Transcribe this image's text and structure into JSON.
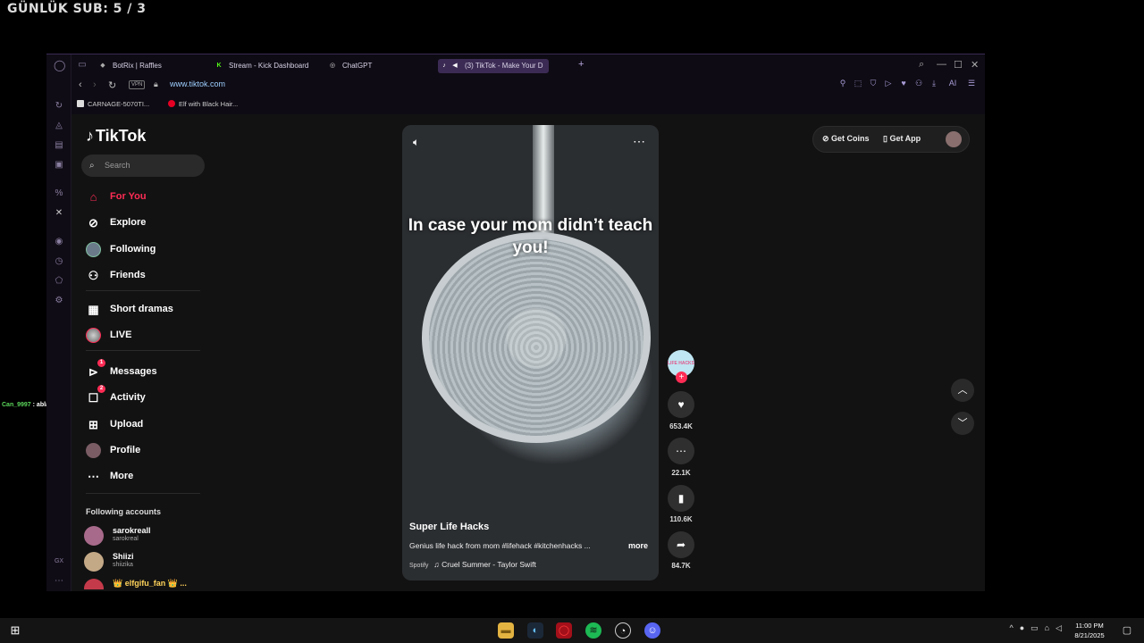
{
  "overlay": {
    "sub_counter": "GÜNLÜK SUB: 5 / 3",
    "chat_user": "Can_9997",
    "chat_msg": ": abla"
  },
  "browser": {
    "tabs": [
      {
        "label": "BotRix | Raffles",
        "fav": "◆"
      },
      {
        "label": "Stream - Kick Dashboard",
        "fav": "K"
      },
      {
        "label": "ChatGPT",
        "fav": "◎"
      },
      {
        "label": "(3) TikTok - Make Your D",
        "fav": "♪"
      }
    ],
    "url": "www.tiktok.com",
    "vpn": "VPN",
    "toolbar_ai": "AI",
    "bookmarks": [
      {
        "label": "CARNAGE-5070TI..."
      },
      {
        "label": "Elf with Black Hair..."
      }
    ]
  },
  "tiktok": {
    "logo": "TikTok",
    "search_placeholder": "Search",
    "nav": [
      {
        "label": "For You"
      },
      {
        "label": "Explore"
      },
      {
        "label": "Following"
      },
      {
        "label": "Friends"
      },
      {
        "label": "Short dramas"
      },
      {
        "label": "LIVE"
      },
      {
        "label": "Messages",
        "badge": "1"
      },
      {
        "label": "Activity",
        "badge": "2"
      },
      {
        "label": "Upload"
      },
      {
        "label": "Profile"
      },
      {
        "label": "More"
      }
    ],
    "following_title": "Following accounts",
    "accounts": [
      {
        "name": "sarokreall",
        "handle": "sarokreal"
      },
      {
        "name": "Shiizi",
        "handle": "shiizika"
      },
      {
        "name": "👑 elfgifu_fan 👑 ..."
      }
    ],
    "top": {
      "coins": "Get Coins",
      "app": "Get App"
    },
    "video": {
      "caption": "In case your mom didn’t teach you!",
      "author": "Super Life Hacks",
      "desc": "Genius life hack from mom #lifehack #kitchenhacks ...",
      "more": "more",
      "spotify": "Spotify",
      "music": "Cruel Summer - Taylor Swift",
      "avatar_text": "LIFE HACKS"
    },
    "stats": {
      "likes": "653.4K",
      "comments": "22.1K",
      "saves": "110.6K",
      "shares": "84.7K"
    }
  },
  "taskbar": {
    "time": "11:00 PM",
    "date": "8/21/2025"
  }
}
